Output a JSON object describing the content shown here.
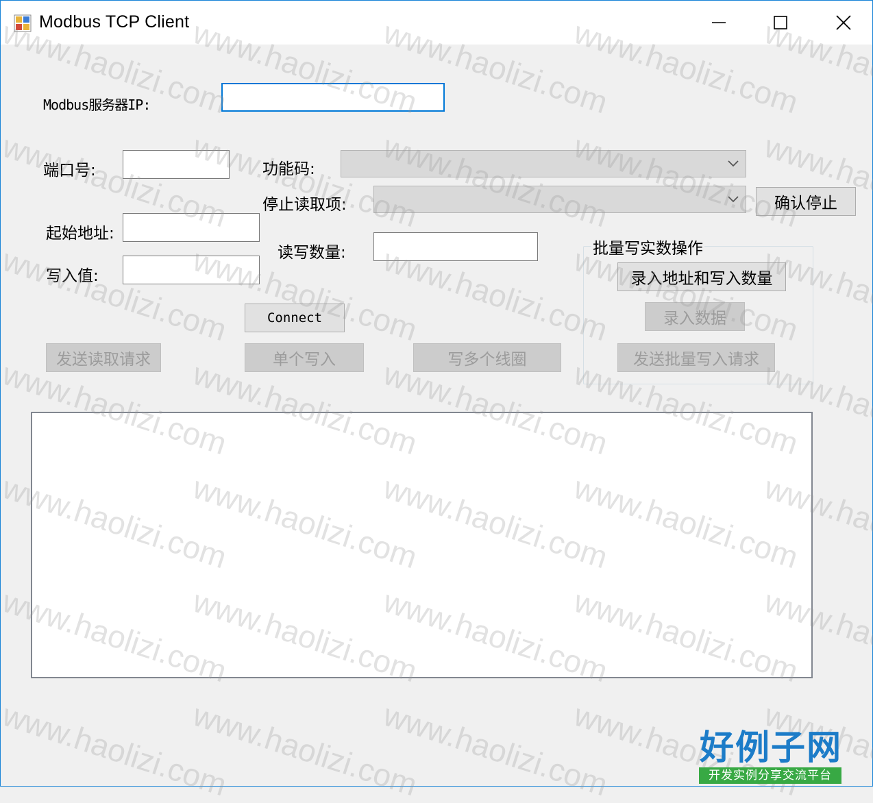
{
  "window": {
    "title": "Modbus TCP Client",
    "controls": {
      "minimize": "minimize-icon",
      "maximize": "maximize-icon",
      "close": "close-icon"
    }
  },
  "form": {
    "server_ip_label": "Modbus服务器IP:",
    "server_ip_value": "",
    "port_label": "端口号:",
    "port_value": "",
    "function_code_label": "功能码:",
    "function_code_value": "",
    "stop_read_label": "停止读取项:",
    "stop_read_value": "",
    "start_addr_label": "起始地址:",
    "start_addr_value": "",
    "rw_count_label": "读写数量:",
    "rw_count_value": "",
    "write_value_label": "写入值:",
    "write_value_value": ""
  },
  "buttons": {
    "confirm_stop": "确认停止",
    "connect": "Connect",
    "send_read": "发送读取请求",
    "single_write": "单个写入",
    "write_coils": "写多个线圈"
  },
  "batch_group": {
    "title": "批量写实数操作",
    "enter_addr_count": "录入地址和写入数量",
    "enter_data": "录入数据",
    "send_batch": "发送批量写入请求"
  },
  "output": {
    "content": ""
  },
  "watermark": {
    "text": "www.haolizi.com"
  },
  "logo": {
    "main": "好例子网",
    "sub": "开发实例分享交流平台"
  },
  "colors": {
    "accent": "#0078d7",
    "window_border": "#1883d7",
    "logo_blue": "#1c7cc8",
    "logo_green": "#38a944"
  }
}
